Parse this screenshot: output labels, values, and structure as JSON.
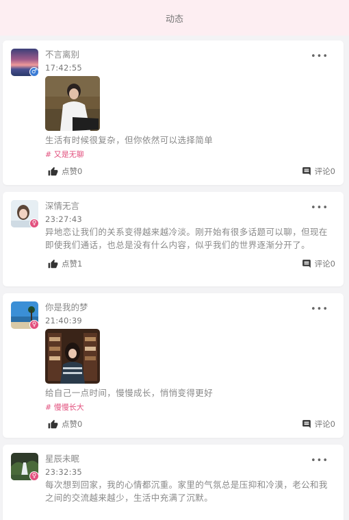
{
  "header": {
    "title": "动态"
  },
  "posts": [
    {
      "name": "不言离别",
      "time": "17:42:55",
      "text": "生活有时候很复杂，但你依然可以选择简单",
      "tag": "# 又是无聊",
      "likes": "点赞0",
      "comments": "评论0",
      "gender": "♂"
    },
    {
      "name": "深情无言",
      "time": "23:27:43",
      "text": "异地恋让我们的关系变得越来越冷淡。刚开始有很多话题可以聊，但现在即使我们通话，也总是没有什么内容，似乎我们的世界逐渐分开了。",
      "likes": "点赞1",
      "comments": "评论0",
      "gender": "♀"
    },
    {
      "name": "你是我的梦",
      "time": "21:40:39",
      "text": "给自己一点时间，慢慢成长，悄悄变得更好",
      "tag": "# 慢慢长大",
      "likes": "点赞0",
      "comments": "评论0",
      "gender": "♀"
    },
    {
      "name": "星辰未眠",
      "time": "23:32:35",
      "text": "每次想到回家，我的心情都沉重。家里的气氛总是压抑和冷漠，老公和我之间的交流越来越少，生活中充满了沉默。",
      "gender": "♀"
    }
  ],
  "more_label": "•••"
}
